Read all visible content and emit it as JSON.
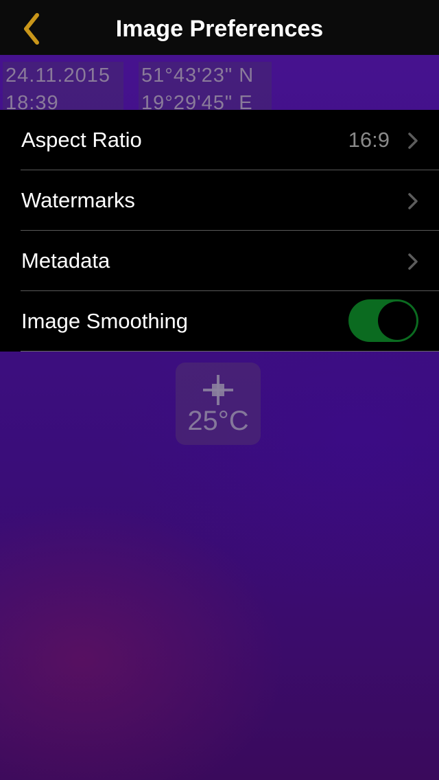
{
  "nav": {
    "title": "Image Preferences",
    "back_icon": "chevron-left-icon",
    "accent_color": "#c9961a"
  },
  "background_overlay": {
    "date": "24.11.2015",
    "time": "18:39",
    "latitude": "51°43'23\" N",
    "longitude": "19°29'45\" E",
    "spot_temperature": "25°C"
  },
  "settings": {
    "aspect_ratio": {
      "label": "Aspect Ratio",
      "value": "16:9"
    },
    "watermarks": {
      "label": "Watermarks"
    },
    "metadata": {
      "label": "Metadata"
    },
    "image_smoothing": {
      "label": "Image Smoothing",
      "enabled": true,
      "on_color": "#0b6b20"
    }
  }
}
